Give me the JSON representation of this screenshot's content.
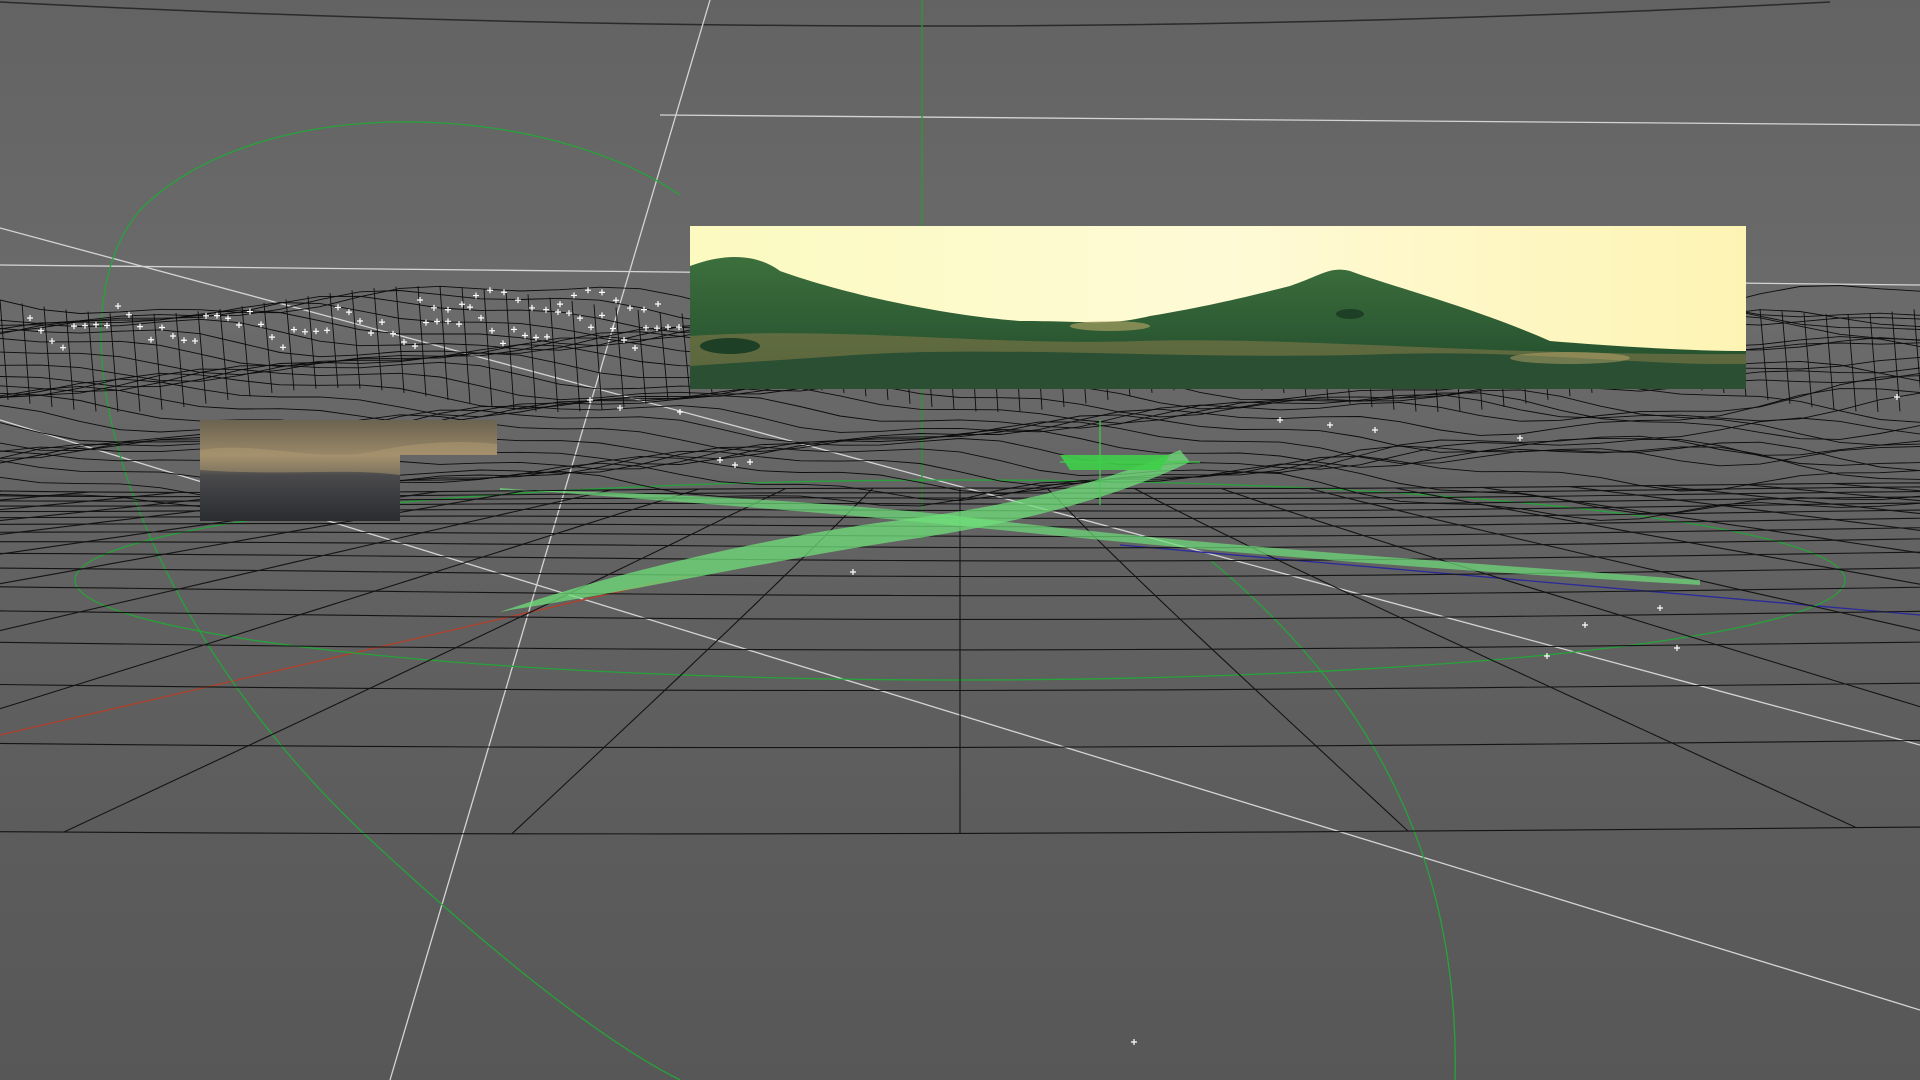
{
  "app": {
    "title": "",
    "view": "3D viewport"
  },
  "scene": {
    "background_colors": [
      "#636363",
      "#575757"
    ],
    "axis_colors": {
      "x": "#b0402c",
      "y": "#2a9a2a",
      "z": "#3030a0"
    },
    "wire_color": "#101010",
    "guide_color": "#d8d8d8",
    "selection_color": "#6fe07a",
    "curve_color": "#26a33a"
  },
  "objects": {
    "render_preview": {
      "label": "",
      "sky_color": "#fefbd0",
      "terrain_color": "#2d6b3c"
    },
    "texture_swatch": {
      "label": ""
    },
    "terrain_mesh": {
      "label": ""
    },
    "camera_path": {
      "label": ""
    },
    "selected_spline": {
      "label": ""
    }
  }
}
